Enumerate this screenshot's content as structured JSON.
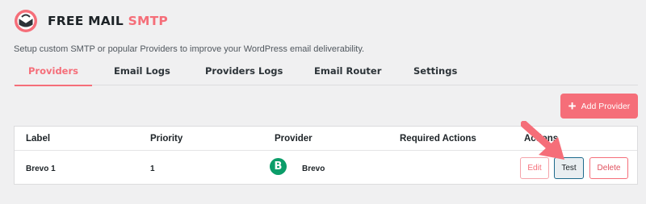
{
  "app": {
    "title_main": "FREE MAIL",
    "title_accent": "SMTP",
    "subtitle": "Setup custom SMTP or popular Providers to improve your WordPress email deliverability."
  },
  "tabs": [
    {
      "label": "Providers",
      "active": true
    },
    {
      "label": "Email Logs",
      "active": false
    },
    {
      "label": "Providers Logs",
      "active": false
    },
    {
      "label": "Email Router",
      "active": false
    },
    {
      "label": "Settings",
      "active": false
    }
  ],
  "toolbar": {
    "add_provider_label": "Add Provider"
  },
  "table": {
    "headers": [
      "Label",
      "Priority",
      "Provider",
      "Required Actions",
      "Actions"
    ],
    "rows": [
      {
        "label": "Brevo 1",
        "priority": "1",
        "provider_logo_letter": "B",
        "provider": "Brevo",
        "required_actions": "",
        "edit_label": "Edit",
        "test_label": "Test",
        "delete_label": "Delete"
      }
    ]
  },
  "colors": {
    "accent": "#f56e79",
    "brevo": "#0b9d69"
  }
}
